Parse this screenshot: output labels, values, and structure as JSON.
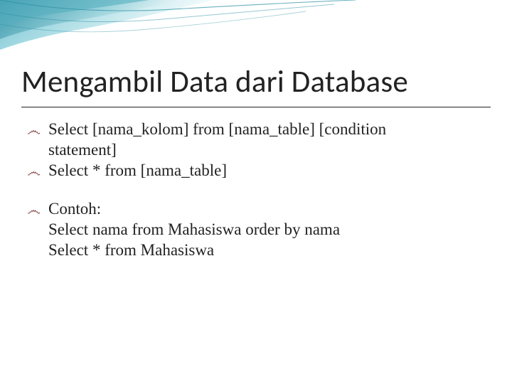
{
  "title": "Mengambil Data dari Database",
  "bullets": {
    "b1_line1": "Select [nama_kolom] from [nama_table] [condition",
    "b1_line2": "statement]",
    "b2": "Select * from [nama_table]",
    "b3": "Contoh:",
    "b3_sub1": "Select nama from Mahasiswa order by nama",
    "b3_sub2": "Select * from Mahasiswa"
  },
  "bullet_glyph": "෴"
}
